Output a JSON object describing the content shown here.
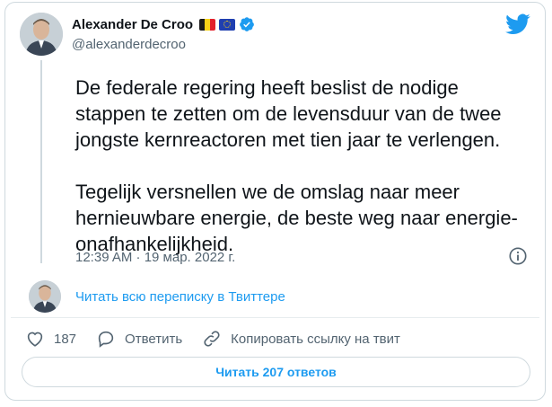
{
  "author": {
    "name": "Alexander De Croo",
    "handle": "@alexanderdecroo"
  },
  "tweet": {
    "text": "De federale regering heeft beslist de nodige\nstappen te zetten om de levensduur van de twee\njongste kernreactoren met tien jaar te verlengen.\n\nTegelijk versnellen we de omslag naar meer\nhernieuwbare energie, de beste weg naar energie-\nonafhankelijkheid.",
    "timestamp": "12:39 AM · 19 мар. 2022 г."
  },
  "thread_link": "Читать всю переписку в Твиттере",
  "actions": {
    "like_count": "187",
    "reply_label": "Ответить",
    "copy_label": "Копировать ссылку на твит"
  },
  "read_replies_label": "Читать 207 ответов",
  "colors": {
    "accent": "#1d9bf0",
    "secondary_text": "#536471",
    "border": "#cfd9de"
  },
  "icons": [
    "twitter-bird-icon",
    "verified-badge-icon",
    "info-icon",
    "heart-icon",
    "reply-bubble-icon",
    "link-icon",
    "belgium-flag-icon",
    "eu-flag-icon"
  ]
}
